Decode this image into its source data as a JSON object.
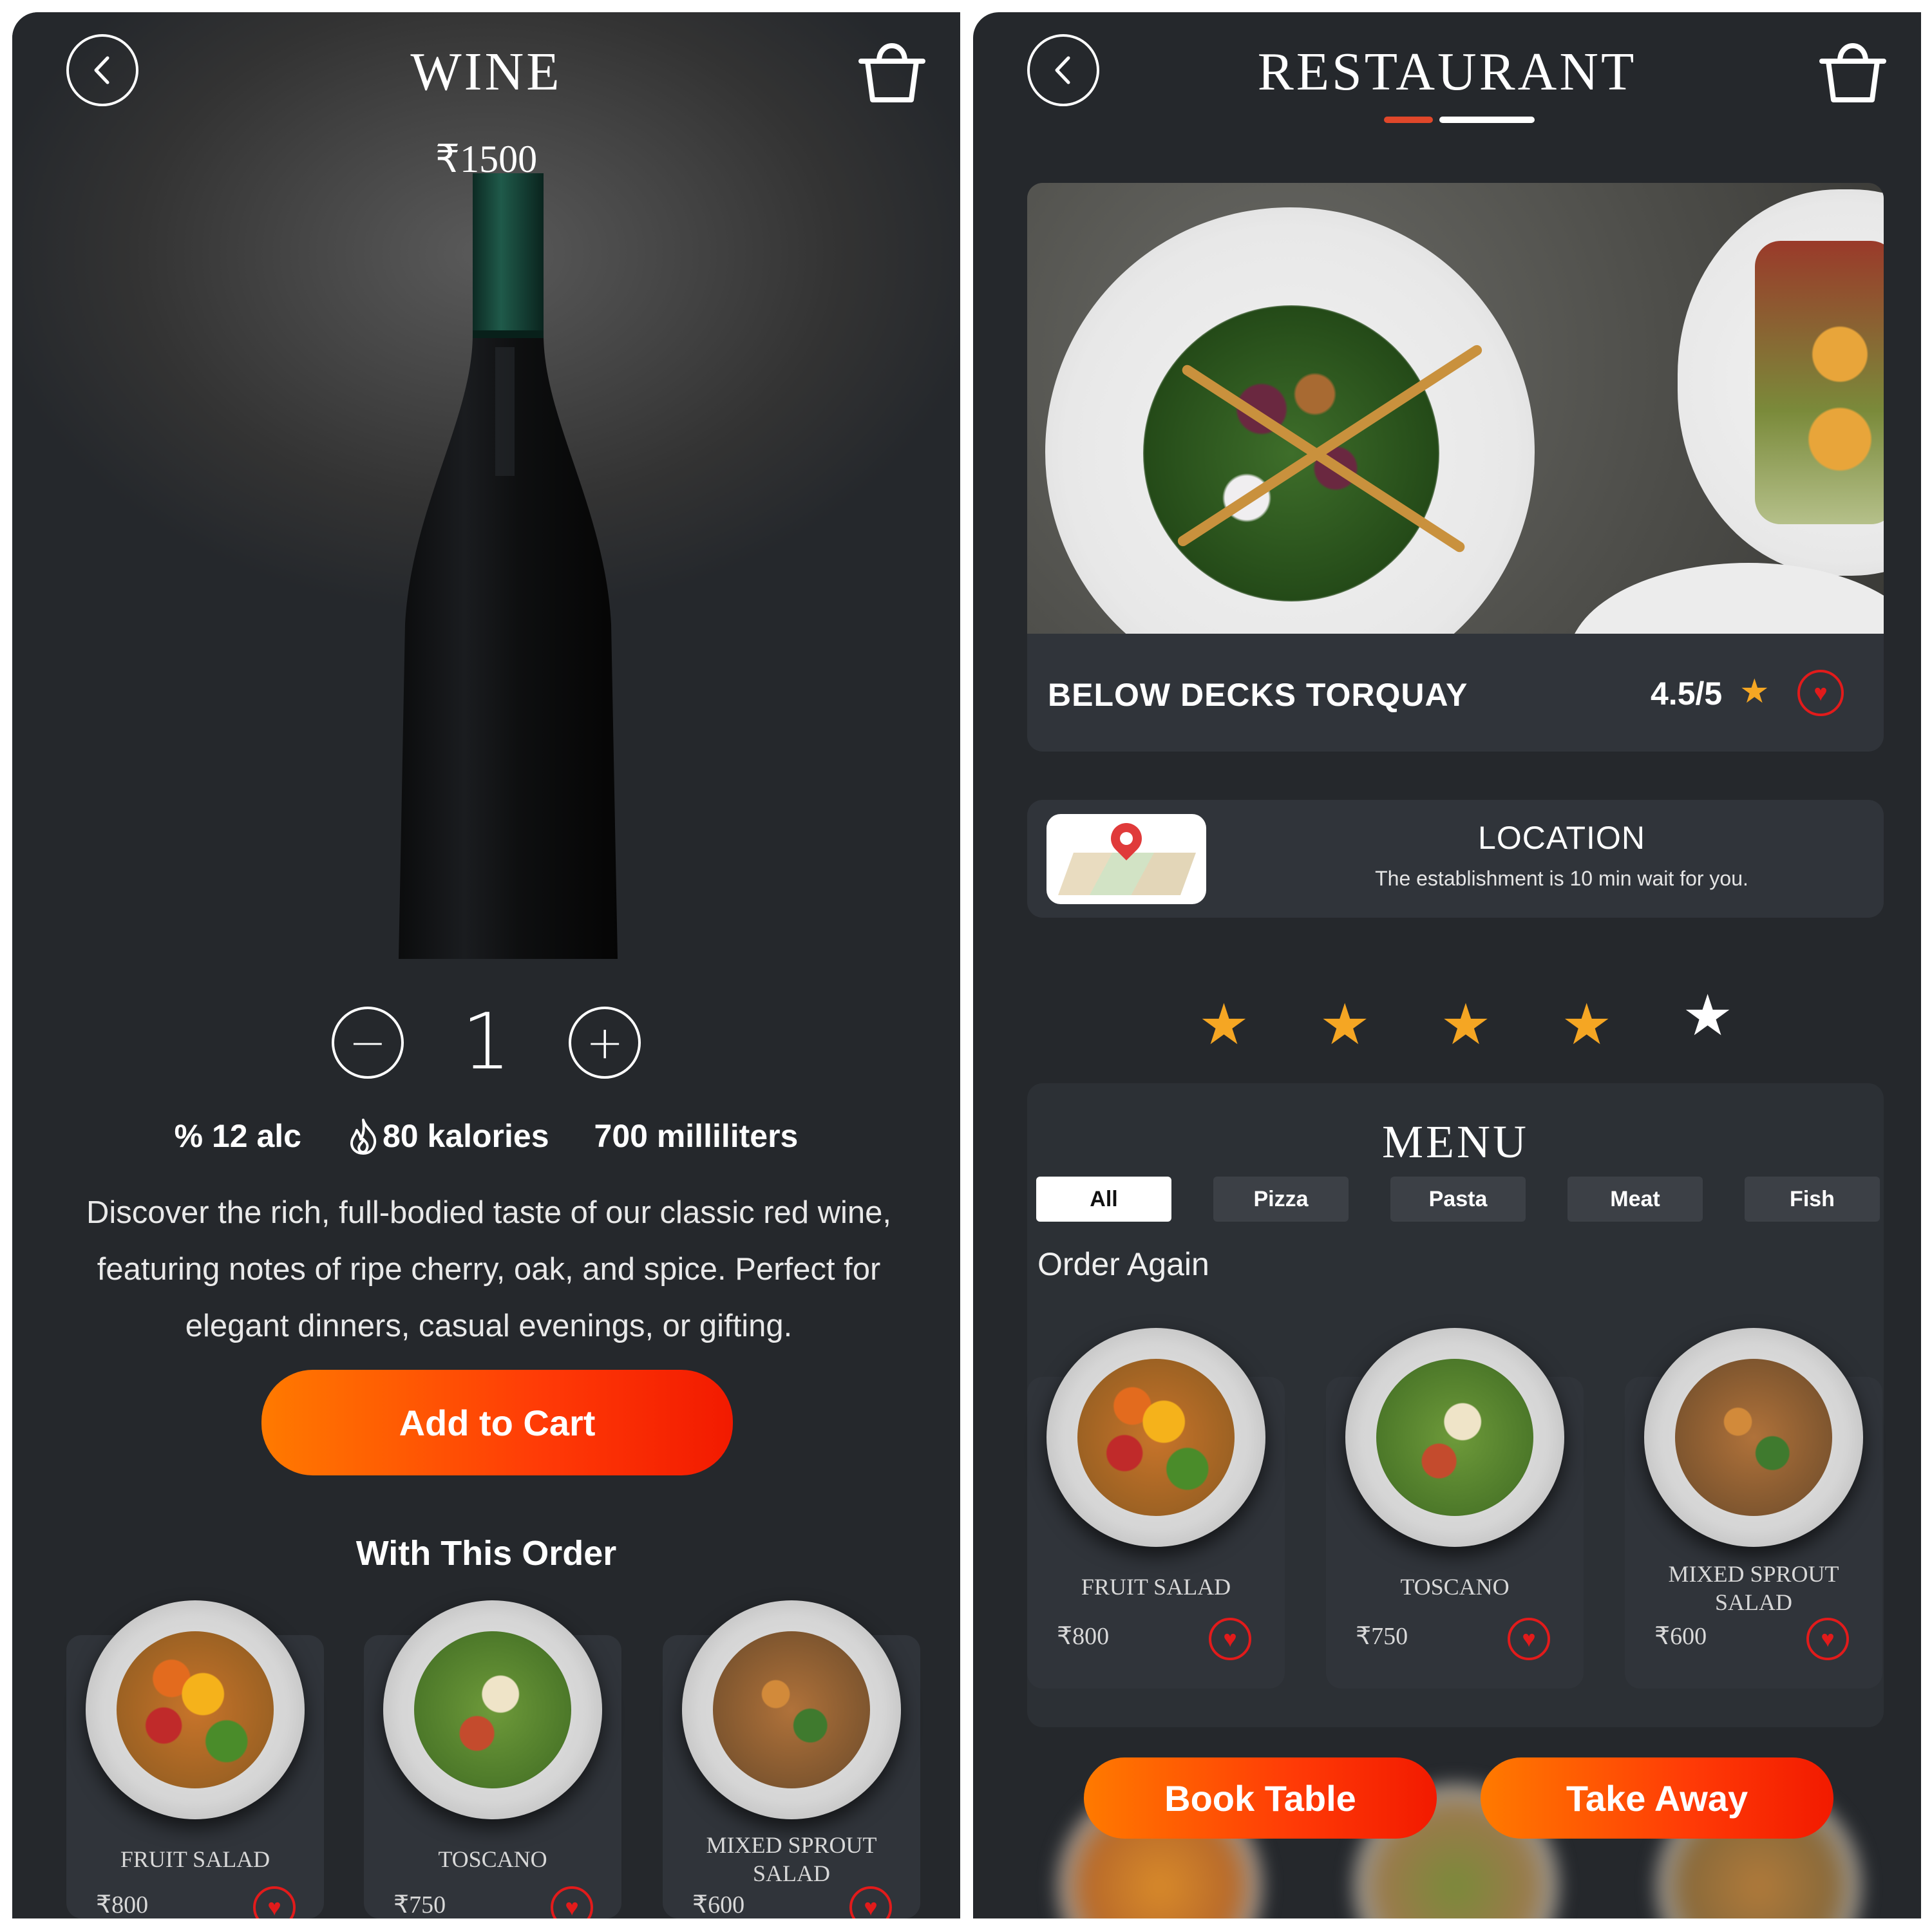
{
  "wine_screen": {
    "title": "WINE",
    "price": "₹1500",
    "quantity": "1",
    "stepper": {
      "minus": "−",
      "plus": "+"
    },
    "specs": {
      "alcohol": "% 12 alc",
      "calories": "80 kalories",
      "volume": "700 milliliters"
    },
    "description": "Discover the rich, full-bodied taste of our classic red wine, featuring notes of ripe cherry, oak, and spice. Perfect for elegant dinners, casual evenings, or gifting.",
    "add_to_cart": "Add to Cart",
    "with_order_title": "With This Order",
    "items": [
      {
        "name": "FRUIT SALAD",
        "price": "₹800"
      },
      {
        "name": "TOSCANO",
        "price": "₹750"
      },
      {
        "name": "MIXED SPROUT SALAD",
        "price": "₹600"
      }
    ]
  },
  "restaurant_screen": {
    "title": "RESTAURANT",
    "restaurant_name": "BELOW DECKS TORQUAY",
    "rating": "4.5/5",
    "location": {
      "title": "LOCATION",
      "subtitle": "The establishment is 10 min wait for you."
    },
    "stars": {
      "filled": 4,
      "total": 5
    },
    "menu": {
      "title": "MENU",
      "categories": [
        "All",
        "Pizza",
        "Pasta",
        "Meat",
        "Fish"
      ],
      "active_category": "All",
      "order_again_label": "Order Again",
      "items": [
        {
          "name": "FRUIT SALAD",
          "price": "₹800"
        },
        {
          "name": "TOSCANO",
          "price": "₹750"
        },
        {
          "name": "MIXED SPROUT SALAD",
          "price": "₹600"
        }
      ]
    },
    "book_table": "Book Table",
    "take_away": "Take Away"
  },
  "colors": {
    "background": "#25282c",
    "card": "#30343a",
    "accent_gradient_start": "#ff7a00",
    "accent_gradient_end": "#f21a00",
    "heart": "#e21b1b",
    "star": "#f5a623",
    "tab_indicator_active": "#e0472a",
    "tab_indicator": "#ffffff"
  },
  "icons": {
    "back": "chevron-left-icon",
    "cart": "shopping-bag-icon",
    "calories": "flame-icon",
    "favorite": "heart-icon",
    "rating": "star-icon",
    "location": "map-pin-icon"
  }
}
